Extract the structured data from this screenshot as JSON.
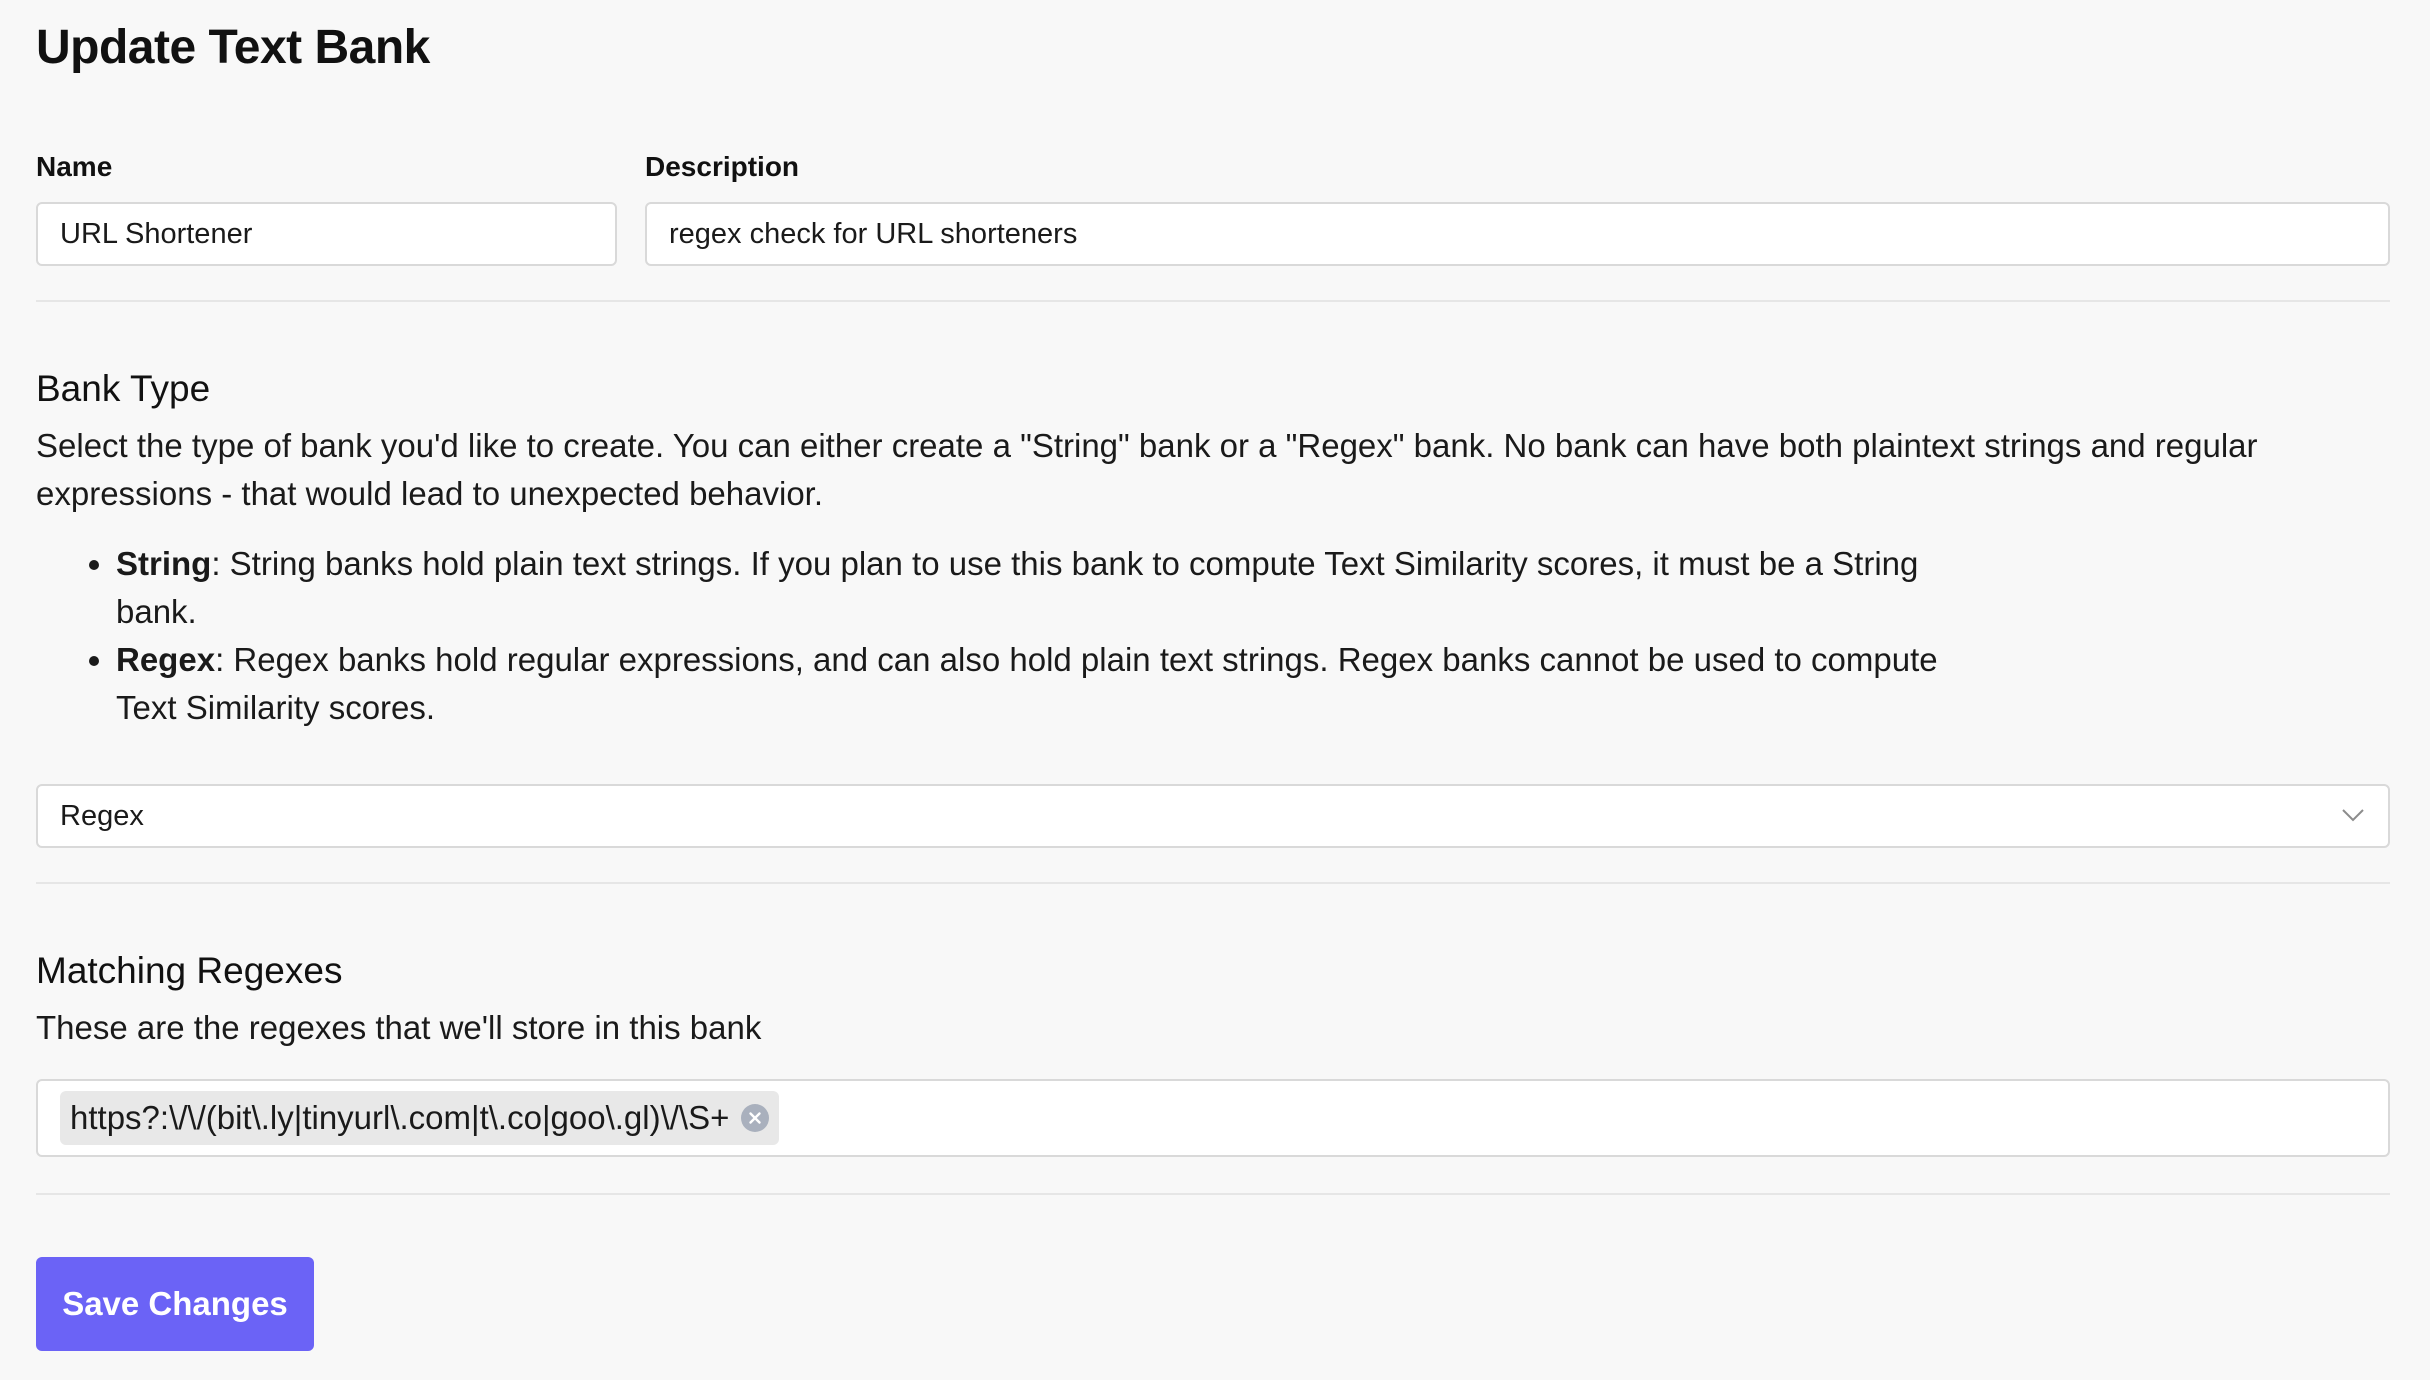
{
  "page": {
    "title": "Update Text Bank"
  },
  "name_field": {
    "label": "Name",
    "value": "URL Shortener"
  },
  "description_field": {
    "label": "Description",
    "value": "regex check for URL shorteners"
  },
  "bank_type": {
    "title": "Bank Type",
    "description": "Select the type of bank you'd like to create. You can either create a \"String\" bank or a \"Regex\" bank. No bank can have both plaintext strings and regular expressions - that would lead to unexpected behavior.",
    "options_info": [
      {
        "name": "String",
        "text": ": String banks hold plain text strings. If you plan to use this bank to compute Text Similarity scores, it must be a String bank."
      },
      {
        "name": "Regex",
        "text": ": Regex banks hold regular expressions, and can also hold plain text strings. Regex banks cannot be used to compute Text Similarity scores."
      }
    ],
    "selected": "Regex",
    "dropdown_icon": "chevron-down-icon"
  },
  "matching_regexes": {
    "title": "Matching Regexes",
    "description": "These are the regexes that we'll store in this bank",
    "tags": [
      "https?:\\/\\/(bit\\.ly|tinyurl\\.com|t\\.co|goo\\.gl)\\/\\S+"
    ],
    "remove_icon": "close-circle-icon"
  },
  "actions": {
    "save_label": "Save Changes"
  },
  "colors": {
    "background": "#f8f8f8",
    "primary_button": "#6b63f6",
    "border": "#d9d9d9",
    "tag_background": "#e8e8e8",
    "tag_close": "#a9b0bd"
  }
}
